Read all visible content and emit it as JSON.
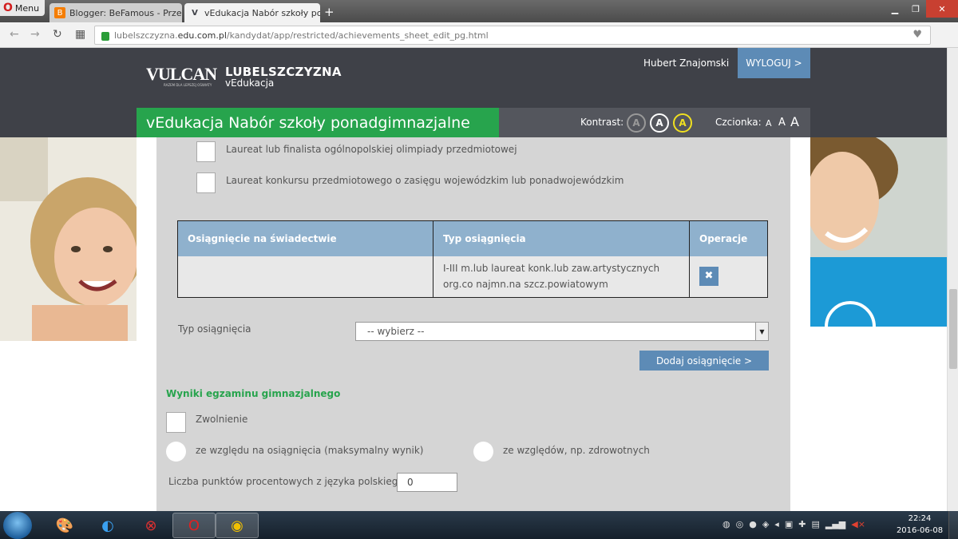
{
  "browser": {
    "menu_label": "Menu",
    "tabs": [
      {
        "title": "Blogger: BeFamous - Przeg",
        "icon": "blogger-icon"
      },
      {
        "title": "vEdukacja Nabór szkoły po",
        "icon": "vulcan-icon"
      }
    ],
    "url_prefix": "lubelszczyzna.",
    "url_domain": "edu.com.pl",
    "url_path": "/kandydat/app/restricted/achievements_sheet_edit_pg.html"
  },
  "site": {
    "logo": "VULCAN",
    "logo_tagline": "RAZEM DLA LEPSZEJ OŚWIATY",
    "region": "LUBELSZCZYZNA",
    "product": "vEdukacja",
    "user_name": "Hubert Znajomski",
    "logout_label": "WYLOGUJ >",
    "page_title": "vEdukacja Nabór szkoły ponadgimnazjalne",
    "contrast_label": "Kontrast:",
    "contrast_options": [
      "A",
      "A",
      "A"
    ],
    "font_label": "Czcionka:",
    "font_options": [
      "A",
      "A",
      "A"
    ]
  },
  "form": {
    "checkboxes": [
      "Laureat lub finalista ogólnopolskiej olimpiady przedmiotowej",
      "Laureat konkursu przedmiotowego o zasięgu wojewódzkim lub ponadwojewódzkim"
    ],
    "table": {
      "headers": [
        "Osiągnięcie na świadectwie",
        "Typ osiągnięcia",
        "Operacje"
      ],
      "rows": [
        {
          "achievement": "",
          "type": "I-III m.lub laureat konk.lub zaw.artystycznych org.co najmn.na szcz.powiatowym",
          "action_icon": "delete-icon"
        }
      ]
    },
    "type_label": "Typ osiągnięcia",
    "type_select_value": "-- wybierz --",
    "add_button": "Dodaj osiągnięcie >",
    "exam_section_title": "Wyniki egzaminu gimnazjalnego",
    "exemption_label": "Zwolnienie",
    "exemption_options": [
      "ze względu na osiągnięcia (maksymalny wynik)",
      "ze względów, np. zdrowotnych"
    ],
    "polish_points_label": "Liczba punktów procentowych z języka polskiego:",
    "polish_points_value": "0"
  },
  "taskbar": {
    "clock_time": "22:24",
    "clock_date": "2016-06-08"
  }
}
